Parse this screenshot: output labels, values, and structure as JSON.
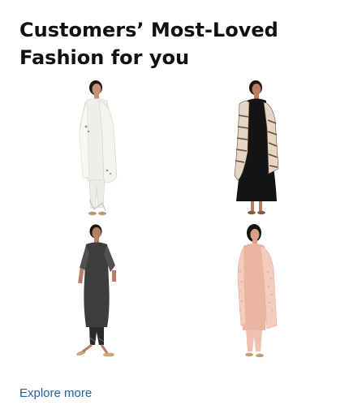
{
  "card": {
    "title": "Customers’ Most-Loved Fashion for you",
    "link_label": "Explore more"
  },
  "products": [
    {
      "icon": "white-kurta-dupatta-set-image",
      "colors": {
        "outfit": "#eeeeea",
        "dupatta": "#f4f4ef",
        "trim": "#b9bdb8"
      }
    },
    {
      "icon": "black-anarkali-print-dupatta-image",
      "colors": {
        "outfit": "#141414",
        "dupatta": "#e4d6c4",
        "trim": "#6b4a38"
      }
    },
    {
      "icon": "grey-kurta-pant-set-image",
      "colors": {
        "outfit": "#3d3d3d",
        "dupatta": "#505050",
        "trim": "#2a2a2a"
      }
    },
    {
      "icon": "peach-kurta-dupatta-set-image",
      "colors": {
        "outfit": "#eab5a2",
        "dupatta": "#f2cdbf",
        "trim": "#e6a994"
      }
    }
  ],
  "colors": {
    "title": "#0f1111",
    "link": "#2162a1",
    "background": "#ffffff"
  }
}
